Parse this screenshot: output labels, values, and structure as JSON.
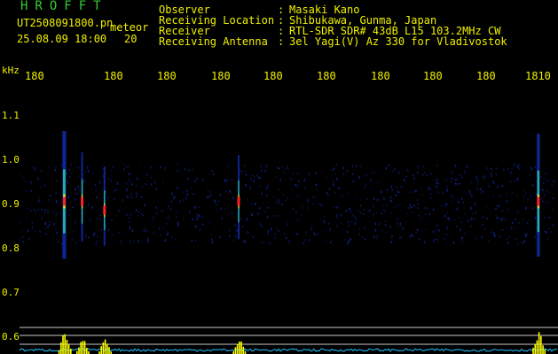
{
  "header": {
    "app_title": "HROFFT",
    "file_name": "UT2508091800.pn",
    "mode_tag": "meteor",
    "date_time": "25.08.09 18:00",
    "scan_count": "20"
  },
  "station_info": [
    {
      "label": "Observer",
      "colon": ":",
      "value": "Masaki Kano"
    },
    {
      "label": "Receiving Location",
      "colon": ":",
      "value": "Shibukawa, Gunma, Japan"
    },
    {
      "label": "Receiver",
      "colon": ":",
      "value": "RTL-SDR SDR# 43dB L15 103.2MHz CW"
    },
    {
      "label": "Receiving Antenna",
      "colon": ":",
      "value": "3el Yagi(V) Az 330 for Vladivostok"
    }
  ],
  "axes": {
    "freq_unit": "kHz",
    "time_ticks": [
      "180",
      "180",
      "180",
      "180",
      "180",
      "180",
      "180",
      "180",
      "180",
      "1810"
    ],
    "freq_ticks": [
      "1.1",
      "1.0",
      "0.9",
      "0.8",
      "0.7",
      "0.6"
    ]
  },
  "colors": {
    "background": "#000000",
    "text": "#f0f000",
    "title": "#33cc33",
    "grid_line": "#c8c8c8",
    "noise": "#1028a0",
    "echo_hot": "#ff2020",
    "echo_warm": "#ffee00",
    "echo_mid": "#30e0a0",
    "power_trace": "#20c0ff",
    "power_bar": "#ffff00"
  },
  "echoes": [
    {
      "time_min": 18,
      "freq_khz": 0.905,
      "strength": 0.95,
      "duration_s": 12
    },
    {
      "time_min": 18.4,
      "freq_khz": 0.905,
      "strength": 0.55,
      "duration_s": 6
    },
    {
      "time_min": 18.9,
      "freq_khz": 0.885,
      "strength": 0.45,
      "duration_s": 4
    },
    {
      "time_min": 21.9,
      "freq_khz": 0.905,
      "strength": 0.5,
      "duration_s": 4
    },
    {
      "time_min": 28.6,
      "freq_khz": 0.905,
      "strength": 0.9,
      "duration_s": 10
    }
  ]
}
